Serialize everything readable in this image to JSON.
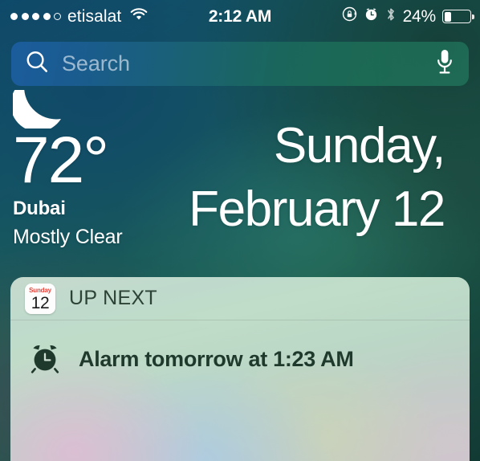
{
  "status_bar": {
    "signal_dots_filled": 4,
    "signal_dots_total": 5,
    "carrier": "etisalat",
    "wifi_icon": "wifi-icon",
    "time": "2:12 AM",
    "rotation_lock_icon": "rotation-lock-icon",
    "alarm_icon": "alarm-clock-icon",
    "bluetooth_icon": "bluetooth-icon",
    "battery_percent": "24%",
    "battery_level": 24
  },
  "search": {
    "placeholder": "Search",
    "value": "",
    "search_icon": "search-icon",
    "mic_icon": "microphone-icon"
  },
  "weather": {
    "condition_icon": "crescent-moon-icon",
    "temperature": "72°",
    "city": "Dubai",
    "condition": "Mostly Clear"
  },
  "date": {
    "line1": "Sunday,",
    "line2": "February 12"
  },
  "up_next": {
    "title": "UP NEXT",
    "calendar_icon": {
      "weekday": "Sunday",
      "day": "12",
      "weekday_color": "#e8453c"
    },
    "items": [
      {
        "icon": "alarm-clock-icon",
        "text": "Alarm tomorrow at 1:23 AM"
      }
    ]
  },
  "colors": {
    "search_bar_left": "#1e60aa",
    "search_bar_right": "#20735a",
    "wallpaper_top": "#0d4a6b",
    "wallpaper_bottom": "#123a34",
    "widget_text": "#1f3a2c",
    "widget_title_text": "#2c4236"
  }
}
